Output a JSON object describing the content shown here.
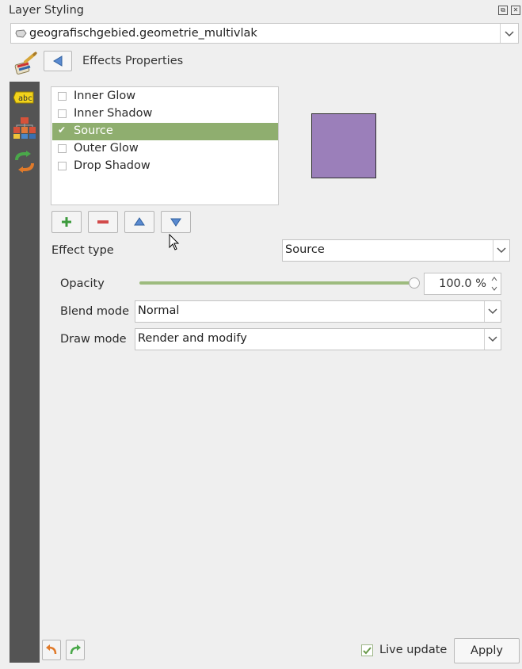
{
  "window": {
    "title": "Layer Styling",
    "float_btn": "⧉",
    "close_btn": "✕"
  },
  "layer_select": {
    "value": "geografischgebied.geometrie_multivlak"
  },
  "panel": {
    "title": "Effects Properties"
  },
  "effects": [
    {
      "label": "Inner Glow",
      "checked": false,
      "selected": false
    },
    {
      "label": "Inner Shadow",
      "checked": false,
      "selected": false
    },
    {
      "label": "Source",
      "checked": true,
      "selected": true
    },
    {
      "label": "Outer Glow",
      "checked": false,
      "selected": false
    },
    {
      "label": "Drop Shadow",
      "checked": false,
      "selected": false
    }
  ],
  "preview": {
    "fill": "#9b7fba",
    "stroke": "#2e2e2e"
  },
  "effect_type": {
    "label": "Effect type",
    "value": "Source"
  },
  "opacity": {
    "label": "Opacity",
    "value_text": "100.0 %",
    "value": 100
  },
  "blend_mode": {
    "label": "Blend mode",
    "value": "Normal"
  },
  "draw_mode": {
    "label": "Draw mode",
    "value": "Render and modify"
  },
  "footer": {
    "live_update": "Live update",
    "live_checked": true,
    "apply": "Apply"
  },
  "colors": {
    "accent": "#8fae6f",
    "sidebar": "#545454"
  }
}
